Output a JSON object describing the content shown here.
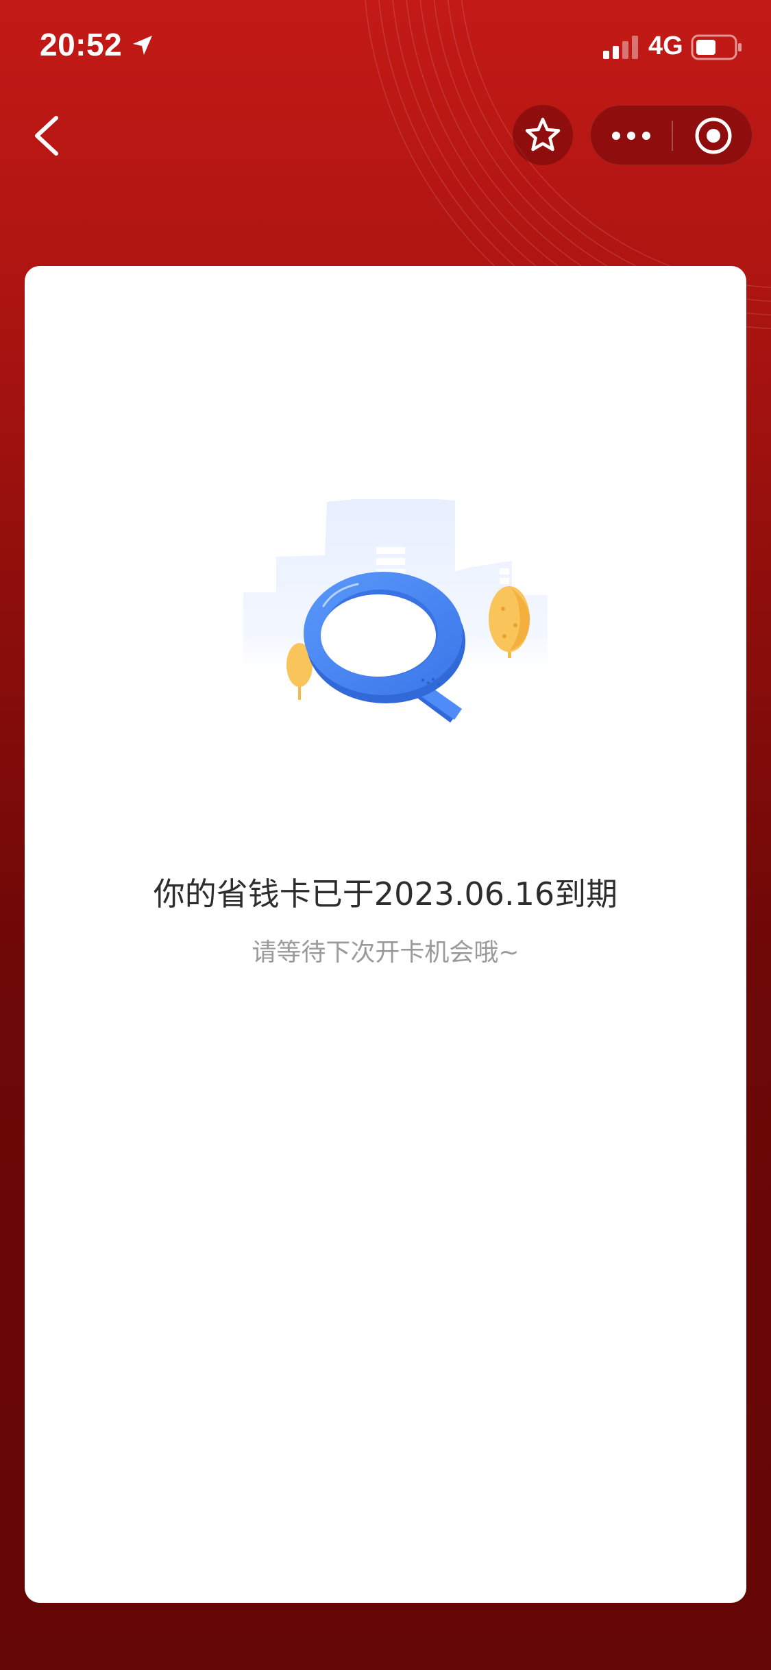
{
  "status_bar": {
    "time": "20:52",
    "network": "4G",
    "icons": [
      "location-arrow-icon",
      "signal-icon",
      "battery-icon"
    ]
  },
  "nav": {
    "icons": [
      "back-chevron-icon",
      "star-icon",
      "more-dots-icon",
      "close-target-icon"
    ]
  },
  "content": {
    "title": "你的省钱卡已于2023.06.16到期",
    "subtitle": "请等待下次开卡机会哦~"
  },
  "colors": {
    "header_red": "#c31a16",
    "bottom_red": "#640605",
    "magnifier_blue": "#4d8df8",
    "tree_yellow": "#f9c55a"
  }
}
